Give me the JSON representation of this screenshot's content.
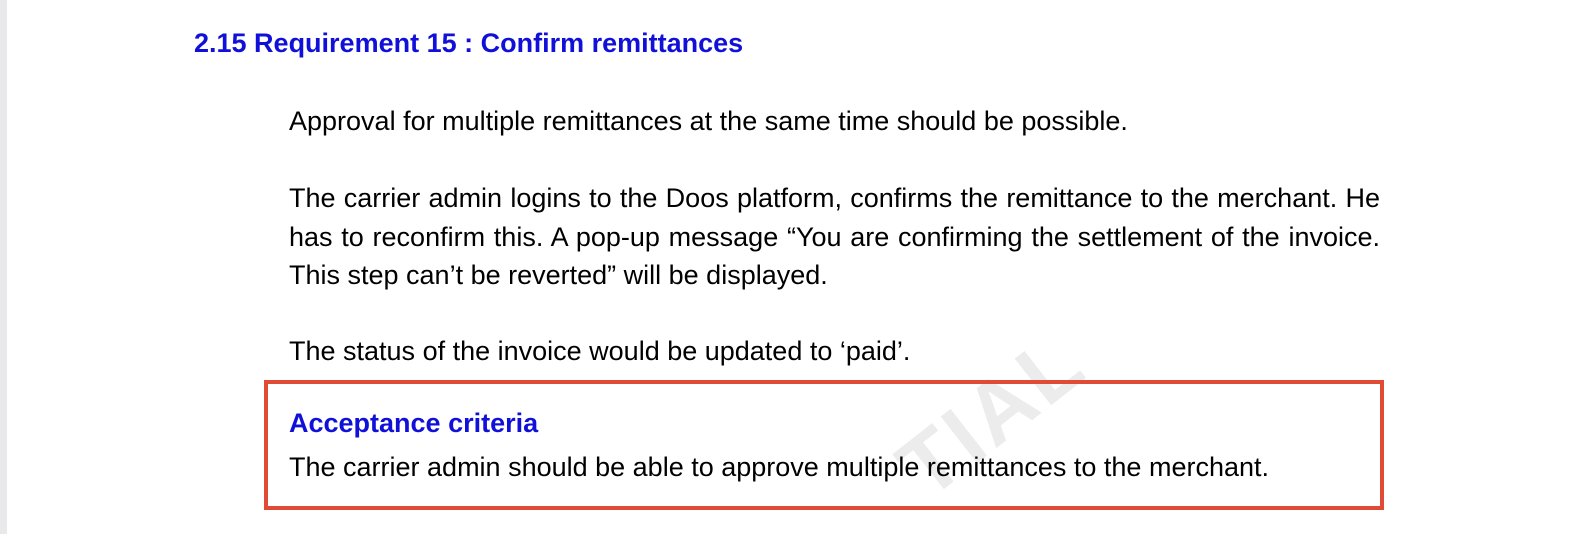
{
  "section": {
    "title": "2.15 Requirement 15 : Confirm remittances"
  },
  "body": {
    "paragraph_1": "Approval for multiple remittances at the same time should be possible.",
    "paragraph_2": "The carrier admin logins to the Doos platform, confirms the remittance to the merchant.  He has to reconfirm this. A pop-up message “You are confirming the settlement of the invoice. This step can’t be reverted” will be displayed.",
    "paragraph_3": "The status of the invoice would be updated to ‘paid’."
  },
  "acceptance": {
    "title": "Acceptance criteria",
    "text": "The carrier admin should be able to approve multiple remittances to the merchant."
  },
  "watermark": {
    "text": "TIAL"
  },
  "colors": {
    "heading": "#1010d8",
    "highlight_border": "#e04b35",
    "body_text": "#000000",
    "watermark": "#ececec"
  }
}
